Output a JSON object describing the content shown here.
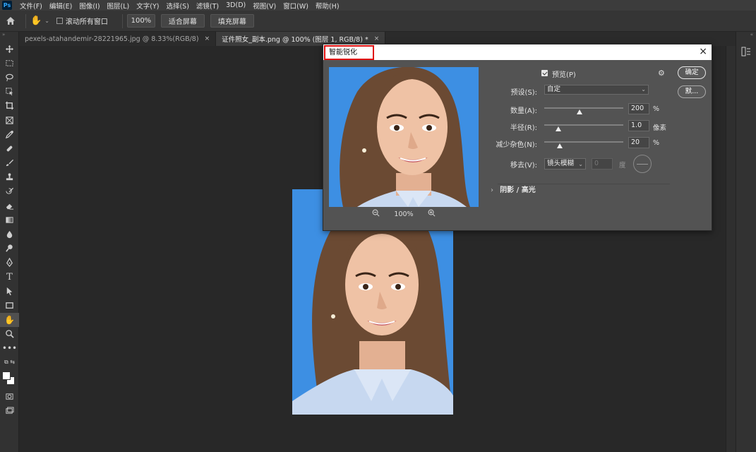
{
  "menu": {
    "logo": "Ps",
    "items": [
      "文件(F)",
      "编辑(E)",
      "图像(I)",
      "图层(L)",
      "文字(Y)",
      "选择(S)",
      "滤镜(T)",
      "3D(D)",
      "视图(V)",
      "窗口(W)",
      "帮助(H)"
    ]
  },
  "options": {
    "scroll_all_label": "滚动所有窗口",
    "zoom_value": "100%",
    "fit_screen": "适合屏幕",
    "fill_screen": "填充屏幕"
  },
  "tabs": [
    {
      "label": "pexels-atahandemir-28221965.jpg @ 8.33%(RGB/8)",
      "close": "×"
    },
    {
      "label": "证件照女_副本.png @ 100% (图层 1, RGB/8) *",
      "close": "×"
    }
  ],
  "dialog": {
    "title": "智能锐化",
    "close": "×",
    "preview_label": "预览(P)",
    "preview_checked": true,
    "ok_label": "确定",
    "default_label": "默...",
    "preset_label": "预设(S):",
    "preset_value": "自定",
    "amount_label": "数量(A):",
    "amount_value": "200",
    "amount_unit": "%",
    "amount_fraction": 0.45,
    "radius_label": "半径(R):",
    "radius_value": "1.0",
    "radius_unit": "像素",
    "radius_fraction": 0.18,
    "noise_label": "减少杂色(N):",
    "noise_value": "20",
    "noise_unit": "%",
    "noise_fraction": 0.2,
    "remove_label": "移去(V):",
    "remove_value": "镜头模糊",
    "angle_value": "0",
    "angle_unit": "度",
    "shadows_label": "阴影 / 高光",
    "zoom_level": "100%"
  }
}
